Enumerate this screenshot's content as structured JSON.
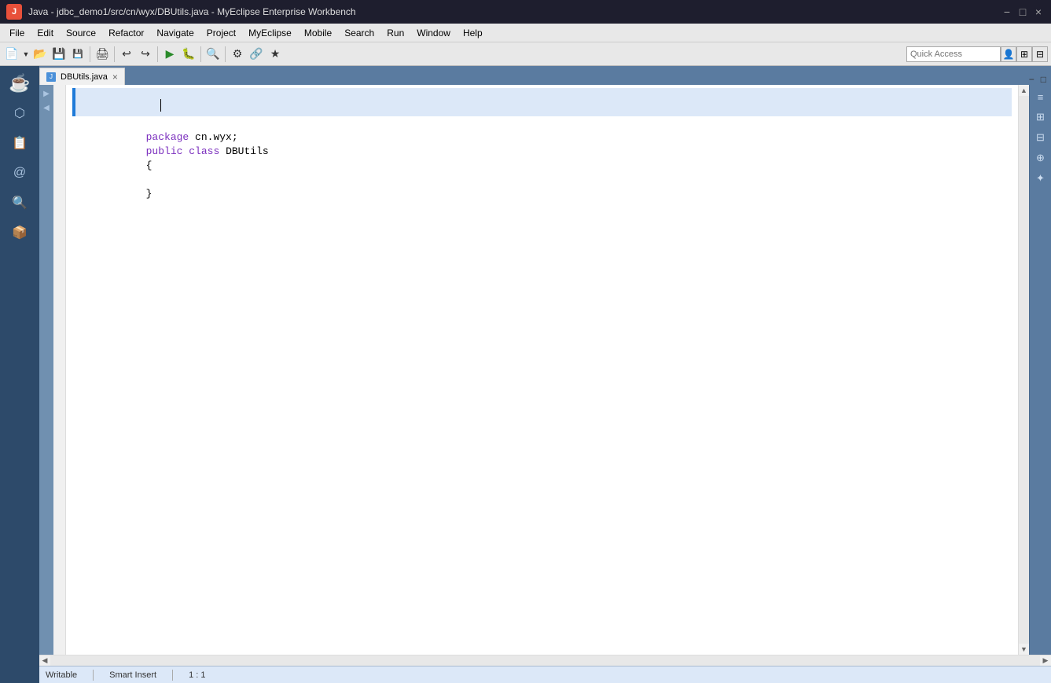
{
  "title_bar": {
    "title": "Java - jdbc_demo1/src/cn/wyx/DBUtils.java - MyEclipse Enterprise Workbench",
    "app_icon_label": "J",
    "minimize": "−",
    "maximize": "□",
    "close": "×"
  },
  "menu_bar": {
    "items": [
      "File",
      "Edit",
      "Source",
      "Refactor",
      "Navigate",
      "Project",
      "MyEclipse",
      "Mobile",
      "Search",
      "Run",
      "Window",
      "Help"
    ]
  },
  "toolbar": {
    "quick_access_placeholder": "Quick Access",
    "quick_access_value": ""
  },
  "tab": {
    "label": "DBUtils.java",
    "close": "×"
  },
  "editor": {
    "lines": [
      {
        "num": "",
        "content": "",
        "highlight": true,
        "tokens": []
      },
      {
        "num": "",
        "content": "package cn.wyx;",
        "highlight": true,
        "tokens": [
          {
            "text": "package",
            "class": "kw-purple"
          },
          {
            "text": " cn.wyx;",
            "class": "code-normal"
          }
        ]
      },
      {
        "num": "",
        "content": "",
        "highlight": false,
        "tokens": []
      },
      {
        "num": "",
        "content": "public class DBUtils",
        "highlight": false,
        "tokens": [
          {
            "text": "public",
            "class": "kw-purple"
          },
          {
            "text": " ",
            "class": "code-normal"
          },
          {
            "text": "class",
            "class": "kw-purple"
          },
          {
            "text": " DBUtils",
            "class": "code-normal"
          }
        ]
      },
      {
        "num": "",
        "content": "{",
        "highlight": false,
        "tokens": [
          {
            "text": "{",
            "class": "code-normal"
          }
        ]
      },
      {
        "num": "",
        "content": "",
        "highlight": false,
        "tokens": []
      },
      {
        "num": "",
        "content": "}",
        "highlight": false,
        "tokens": [
          {
            "text": "}",
            "class": "code-normal"
          }
        ]
      }
    ]
  },
  "status_bar": {
    "writable": "Writable",
    "smart_insert": "Smart Insert",
    "position": "1 : 1"
  },
  "right_sidebar": {
    "icons": [
      "≡",
      "⊞",
      "⊟",
      "⊕",
      "✦"
    ]
  }
}
